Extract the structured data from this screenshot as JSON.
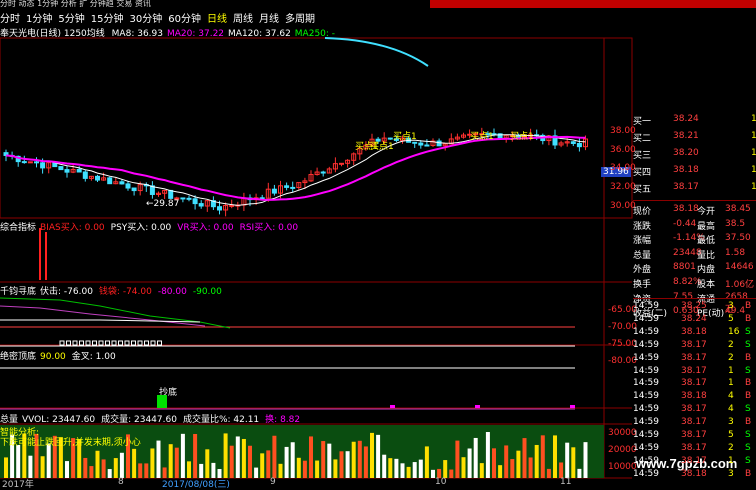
{
  "menu": "分时 动态 1分钟 分析 扩 分钟趋 交易 资讯",
  "periods": [
    "分时",
    "1分钟",
    "5分钟",
    "15分钟",
    "30分钟",
    "60分钟",
    "日线",
    "周线",
    "月线",
    "多周期"
  ],
  "active_period": "日线",
  "stock_title": "奉天光电(日线) 1250均线",
  "ma": [
    {
      "label": "MA8: 36.93",
      "color": "#ffffff"
    },
    {
      "label": "MA20: 37.22",
      "color": "#ff00ff"
    },
    {
      "label": "MA120: 37.62",
      "color": "#ffffff"
    },
    {
      "label": "MA250: -",
      "color": "#00ff00"
    }
  ],
  "price_axis": [
    "38.00",
    "36.00",
    "34.00",
    "32.00",
    "30.00"
  ],
  "current_price_box": "31.96",
  "low_label": "←29.87",
  "buy_marks": [
    "买点1",
    "买点1",
    "买点1",
    "买点1",
    "买点1"
  ],
  "indicator1": {
    "name": "综合指标",
    "parts": [
      {
        "t": "BIAS买入: 0.00",
        "c": "#ff2020"
      },
      {
        "t": "PSY买入: 0.00",
        "c": "#ffffff"
      },
      {
        "t": "VR买入: 0.00",
        "c": "#ff00ff"
      },
      {
        "t": "RSI买入: 0.00",
        "c": "#ff00ff"
      }
    ]
  },
  "indicator2": {
    "name": "千钧寻底",
    "parts": [
      {
        "t": "伏击: -76.00",
        "c": "#ffffff"
      },
      {
        "t": "钱袋: -74.00",
        "c": "#ff2020"
      },
      {
        "t": "-80.00",
        "c": "#ff00ff"
      },
      {
        "t": "-90.00",
        "c": "#00ff00"
      }
    ],
    "axis": [
      "-65.00",
      "-70.00",
      "-75.00",
      "-80.00"
    ]
  },
  "indicator3": {
    "name": "绝密顶底",
    "parts": [
      {
        "t": "90.00",
        "c": "#ffff00"
      },
      {
        "t": "金叉: 1.00",
        "c": "#ffffff"
      }
    ]
  },
  "chaodi_label": "抄底",
  "volume": {
    "name": "总量",
    "parts": [
      {
        "t": "VVOL: 23447.60",
        "c": "#ffffff"
      },
      {
        "t": "成交量: 23447.60",
        "c": "#ffffff"
      },
      {
        "t": "成交量比%: 42.11",
        "c": "#ffffff"
      },
      {
        "t": "换: 8.82",
        "c": "#ff00ff"
      }
    ],
    "axis": [
      "30000",
      "20000",
      "10000"
    ]
  },
  "smart": {
    "title": "智能分析:",
    "text": "下跌可能止跌回升,并发末期,须小心"
  },
  "x_axis": [
    "2017年",
    "8",
    "2017/08/08(三)",
    "9",
    "10",
    "11"
  ],
  "quote_book": [
    {
      "label": "买一",
      "price": "38.24",
      "tail": "1"
    },
    {
      "label": "买二",
      "price": "38.21",
      "tail": "1"
    },
    {
      "label": "买三",
      "price": "38.20",
      "tail": "1"
    },
    {
      "label": "买四",
      "price": "38.18",
      "tail": "1"
    },
    {
      "label": "买五",
      "price": "38.17",
      "tail": "1"
    }
  ],
  "stats": [
    {
      "a": "现价",
      "av": "38.18",
      "b": "今开",
      "bv": "38.45"
    },
    {
      "a": "涨跌",
      "av": "-0.44",
      "b": "最高",
      "bv": "38.5"
    },
    {
      "a": "涨幅",
      "av": "-1.14%",
      "b": "最低",
      "bv": "37.50"
    },
    {
      "a": "总量",
      "av": "23448",
      "b": "量比",
      "bv": "1.58"
    },
    {
      "a": "外盘",
      "av": "8801",
      "b": "内盘",
      "bv": "14646"
    },
    {
      "a": "换手",
      "av": "8.82%",
      "b": "股本",
      "bv": "1.06亿"
    },
    {
      "a": "净资",
      "av": "7.55",
      "b": "流通",
      "bv": "2658万"
    },
    {
      "a": "收益(二)",
      "av": "0.630",
      "b": "PE(动)",
      "bv": "49.4"
    }
  ],
  "ticks": [
    {
      "t": "14:59",
      "p": "38.25",
      "v": "3",
      "s": "B"
    },
    {
      "t": "14:59",
      "p": "38.24",
      "v": "5",
      "s": "B"
    },
    {
      "t": "14:59",
      "p": "38.18",
      "v": "16",
      "s": "S"
    },
    {
      "t": "14:59",
      "p": "38.17",
      "v": "2",
      "s": "S"
    },
    {
      "t": "14:59",
      "p": "38.17",
      "v": "2",
      "s": "B"
    },
    {
      "t": "14:59",
      "p": "38.17",
      "v": "1",
      "s": "S"
    },
    {
      "t": "14:59",
      "p": "38.17",
      "v": "1",
      "s": "B"
    },
    {
      "t": "14:59",
      "p": "38.18",
      "v": "4",
      "s": "B"
    },
    {
      "t": "14:59",
      "p": "38.17",
      "v": "4",
      "s": "S"
    },
    {
      "t": "14:59",
      "p": "38.17",
      "v": "3",
      "s": "B"
    },
    {
      "t": "14:59",
      "p": "38.17",
      "v": "5",
      "s": "S"
    },
    {
      "t": "14:59",
      "p": "38.17",
      "v": "2",
      "s": "S"
    },
    {
      "t": "14:59",
      "p": "38.17",
      "v": "1",
      "s": "S"
    },
    {
      "t": "14:59",
      "p": "38.18",
      "v": "3",
      "s": "B"
    }
  ],
  "watermark": "www.7gpzb.com"
}
